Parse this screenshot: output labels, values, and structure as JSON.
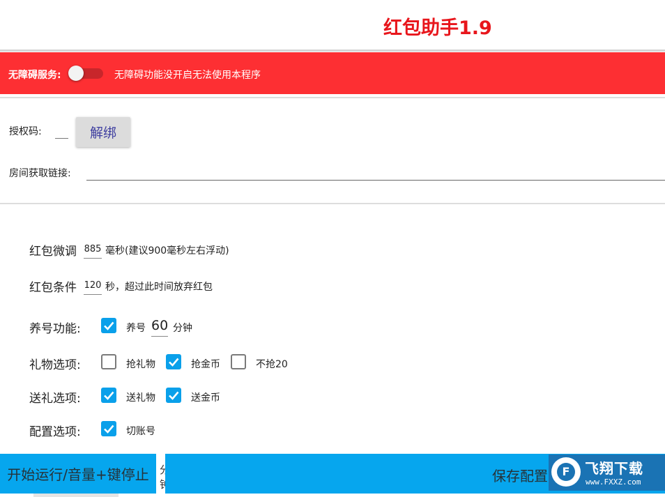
{
  "app": {
    "title": "红包助手1.9"
  },
  "accessibility": {
    "label": "无障碍服务:",
    "enabled": false,
    "message": "无障碍功能没开启无法使用本程序"
  },
  "auth": {
    "code_label": "授权码:",
    "code_value": "",
    "unbind_label": "解绑",
    "room_label": "房间获取链接:",
    "room_value": ""
  },
  "settings": {
    "fine_tune": {
      "label": "红包微调",
      "value": "885",
      "suffix": "毫秒(建议900毫秒左右浮动)"
    },
    "condition": {
      "label": "红包条件",
      "value": "120",
      "suffix": "秒，超过此时间放弃红包"
    },
    "nurture": {
      "label": "养号功能:",
      "checkbox_label": "养号",
      "checked": true,
      "value": "60",
      "suffix": "分钟"
    },
    "gift": {
      "label": "礼物选项:",
      "options": [
        {
          "label": "抢礼物",
          "checked": false
        },
        {
          "label": "抢金币",
          "checked": true
        },
        {
          "label": "不抢20",
          "checked": false
        }
      ]
    },
    "send": {
      "label": "送礼选项:",
      "options": [
        {
          "label": "送礼物",
          "checked": true
        },
        {
          "label": "送金币",
          "checked": true
        }
      ]
    },
    "config": {
      "label": "配置选项:",
      "options": [
        {
          "label": "切账号",
          "checked": true
        }
      ]
    }
  },
  "footer": {
    "start_label": "开始运行/音量+键停止",
    "partial_hidden_text": "分钟",
    "save_label": "保存配置"
  },
  "watermark": {
    "brand": "飞翔下载",
    "url": "www.FXXZ.com",
    "mark": "F"
  },
  "colors": {
    "accent": "#06a6ee",
    "title_red": "#e8161c",
    "alert_red": "#fd2f33",
    "checkbox_blue": "#0aa0ea"
  },
  "icons": {
    "checkbox_checked": "check-icon",
    "toggle": "switch-icon"
  }
}
